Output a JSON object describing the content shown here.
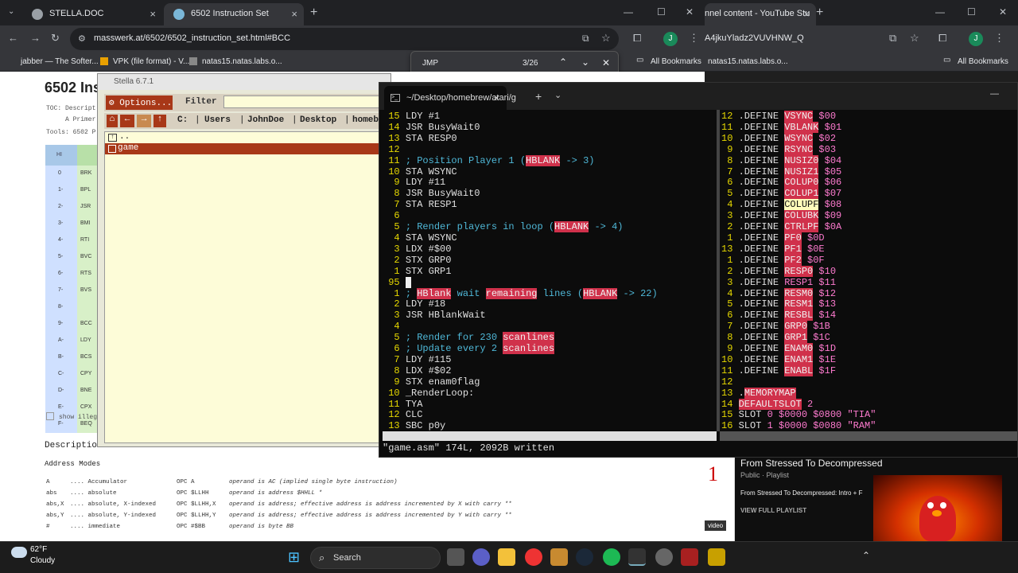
{
  "chrome_left": {
    "tabs": [
      {
        "label": "STELLA.DOC",
        "close": "×"
      },
      {
        "label": "6502 Instruction Set",
        "close": "×"
      }
    ],
    "new_tab": "+",
    "url": "masswerk.at/6502/6502_instruction_set.html#BCC",
    "bookmarks": [
      "jabber — The Softer...",
      "VPK (file format) - V...",
      "natas15.natas.labs.o..."
    ],
    "find": {
      "query": "JMP",
      "count": "3/26"
    },
    "all_bookmarks": "All Bookmarks",
    "profile": "J"
  },
  "chrome_right": {
    "tab_label": "nnel content - YouTube Stu",
    "url": "A4jkuYladz2VUVHNW_Q",
    "bookmarks": [
      "natas15.natas.labs.o..."
    ],
    "all_bookmarks": "All Bookmarks",
    "profile": "J"
  },
  "page": {
    "title": "6502 Ins",
    "toc": "TOC: Descript",
    "toc2": "A Primer",
    "tools": "Tools: 6502 P",
    "table_header": "HI",
    "opcodes": [
      {
        "hi": "0",
        "op": "BRK"
      },
      {
        "hi": "1-",
        "op": "BPL"
      },
      {
        "hi": "2-",
        "op": "JSR"
      },
      {
        "hi": "3-",
        "op": "BMI"
      },
      {
        "hi": "4-",
        "op": "RTI"
      },
      {
        "hi": "5-",
        "op": "BVC"
      },
      {
        "hi": "6-",
        "op": "RTS"
      },
      {
        "hi": "7-",
        "op": "BVS"
      },
      {
        "hi": "8-",
        "op": ""
      },
      {
        "hi": "9-",
        "op": "BCC"
      },
      {
        "hi": "A-",
        "op": "LDY"
      },
      {
        "hi": "B-",
        "op": "BCS"
      },
      {
        "hi": "C-",
        "op": "CPY"
      },
      {
        "hi": "D-",
        "op": "BNE"
      },
      {
        "hi": "E-",
        "op": "CPX"
      },
      {
        "hi": "F-",
        "op": "BEQ"
      }
    ],
    "show_illegal": "show illeg",
    "description": "Description",
    "address_modes": "Address Modes",
    "modes": [
      {
        "m": "A",
        "d": ".... Accumulator",
        "o": "OPC A",
        "e": "operand is AC (implied single byte instruction)"
      },
      {
        "m": "abs",
        "d": ".... absolute",
        "o": "OPC $LLHH",
        "e": "operand is address $HHLL *"
      },
      {
        "m": "abs,X",
        "d": ".... absolute, X-indexed",
        "o": "OPC $LLHH,X",
        "e": "operand is address; effective address is address incremented by X with carry **"
      },
      {
        "m": "abs,Y",
        "d": ".... absolute, Y-indexed",
        "o": "OPC $LLHH,Y",
        "e": "operand is address; effective address is address incremented by Y with carry **"
      },
      {
        "m": "#",
        "d": ".... immediate",
        "o": "OPC #$BB",
        "e": "operand is byte BB"
      }
    ]
  },
  "stella": {
    "title": "Stella 6.7.1",
    "options": "Options...",
    "filter": "Filter",
    "path": [
      "C:",
      "Users",
      "JohnDoe",
      "Desktop",
      "homeb"
    ],
    "items": [
      "..",
      "game"
    ]
  },
  "terminal": {
    "tab": "~/Desktop/homebrew/atari/g",
    "status": "\"game.asm\" 174L, 2092B written",
    "left_lines": [
      {
        "n": "15",
        "t": "LDY #1"
      },
      {
        "n": "14",
        "t": "JSR BusyWait0"
      },
      {
        "n": "13",
        "t": "STA RESP0"
      },
      {
        "n": "12",
        "t": ""
      },
      {
        "n": "11",
        "c": "; Position Player 1 (",
        "h": "HBLANK",
        "r": " -> 3)"
      },
      {
        "n": "10",
        "t": "STA WSYNC"
      },
      {
        "n": "9",
        "t": "LDY #11"
      },
      {
        "n": "8",
        "t": "JSR BusyWait0"
      },
      {
        "n": "7",
        "t": "STA RESP1"
      },
      {
        "n": "6",
        "t": ""
      },
      {
        "n": "5",
        "c": "; Render players in loop (",
        "h": "HBLANK",
        "r": " -> 4)"
      },
      {
        "n": "4",
        "t": "STA WSYNC"
      },
      {
        "n": "3",
        "t": "LDX #$00"
      },
      {
        "n": "2",
        "t": "STX GRP0"
      },
      {
        "n": "1",
        "t": "STX GRP1"
      },
      {
        "n": "95",
        "t": ""
      },
      {
        "n": "1",
        "special": "hblank"
      },
      {
        "n": "2",
        "t": "LDY #18"
      },
      {
        "n": "3",
        "t": "JSR HBlankWait"
      },
      {
        "n": "4",
        "t": ""
      },
      {
        "n": "5",
        "c": "; Render for 230 ",
        "h": "scanlines",
        "r": ""
      },
      {
        "n": "6",
        "c": "; Update every 2 ",
        "h": "scanlines",
        "r": ""
      },
      {
        "n": "7",
        "t": "LDY #115"
      },
      {
        "n": "8",
        "t": "LDX #$02"
      },
      {
        "n": "9",
        "t": "STX enam0flag"
      },
      {
        "n": "10",
        "t": "_RenderLoop:"
      },
      {
        "n": "11",
        "t": "TYA"
      },
      {
        "n": "12",
        "t": "CLC"
      },
      {
        "n": "13",
        "t": "SBC p0y"
      }
    ],
    "hblank_line": {
      "a": "; ",
      "b": "HBlank",
      "c": " wait ",
      "d": "remaining",
      "e": " lines (",
      "f": "HBLANK",
      "g": " -> 22)"
    },
    "right_lines": [
      {
        "n": "12",
        "k": ".DEFINE ",
        "v": "VSYNC",
        "d": " $00"
      },
      {
        "n": "11",
        "k": ".DEFINE ",
        "v": "VBLANK",
        "d": " $01"
      },
      {
        "n": "10",
        "k": ".DEFINE ",
        "v": "WSYNC",
        "d": " $02"
      },
      {
        "n": "9",
        "k": ".DEFINE ",
        "v": "RSYNC",
        "d": " $03"
      },
      {
        "n": "8",
        "k": ".DEFINE ",
        "v": "NUSIZ0",
        "d": " $04"
      },
      {
        "n": "7",
        "k": ".DEFINE ",
        "v": "NUSIZ1",
        "d": " $05"
      },
      {
        "n": "6",
        "k": ".DEFINE ",
        "v": "COLUP0",
        "d": " $06"
      },
      {
        "n": "5",
        "k": ".DEFINE ",
        "v": "COLUP1",
        "d": " $07"
      },
      {
        "n": "4",
        "k": ".DEFINE ",
        "v": "COLUPF",
        "d": " $08",
        "y": true
      },
      {
        "n": "3",
        "k": ".DEFINE ",
        "v": "COLUBK",
        "d": " $09"
      },
      {
        "n": "2",
        "k": ".DEFINE ",
        "v": "CTRLPF",
        "d": " $0A"
      },
      {
        "n": "1",
        "k": ".DEFINE ",
        "v": "PF0",
        "d": " $0D"
      },
      {
        "n": "13",
        "k": ".DEFINE ",
        "v": "PF1",
        "d": " $0E"
      },
      {
        "n": "1",
        "k": ".DEFINE ",
        "v": "PF2",
        "d": " $0F"
      },
      {
        "n": "2",
        "k": ".DEFINE ",
        "v": "RESP0",
        "d": " $10"
      },
      {
        "n": "3",
        "k": ".DEFINE ",
        "v": "",
        "d": "RESP1 $11"
      },
      {
        "n": "4",
        "k": ".DEFINE ",
        "v": "RESM0",
        "d": " $12"
      },
      {
        "n": "5",
        "k": ".DEFINE ",
        "v": "RESM1",
        "d": " $13"
      },
      {
        "n": "6",
        "k": ".DEFINE ",
        "v": "RESBL",
        "d": " $14"
      },
      {
        "n": "7",
        "k": ".DEFINE ",
        "v": "GRP0",
        "d": " $1B"
      },
      {
        "n": "8",
        "k": ".DEFINE ",
        "v": "GRP1",
        "d": " $1C"
      },
      {
        "n": "9",
        "k": ".DEFINE ",
        "v": "ENAM0",
        "d": " $1D"
      },
      {
        "n": "10",
        "k": ".DEFINE ",
        "v": "ENAM1",
        "d": " $1E"
      },
      {
        "n": "11",
        "k": ".DEFINE ",
        "v": "ENABL",
        "d": " $1F"
      },
      {
        "n": "12",
        "k": "",
        "v": "",
        "d": ""
      },
      {
        "n": "13",
        "k": ".",
        "v": "MEMORYMAP",
        "d": ""
      },
      {
        "n": "14",
        "k": "",
        "v": "DEFAULTSLOT",
        "d": " 2"
      },
      {
        "n": "15",
        "k": "SLOT ",
        "v": "",
        "d": "0 $0000 $0800 \"TIA\""
      },
      {
        "n": "16",
        "k": "SLOT ",
        "v": "",
        "d": "1 $0000 $0080 \"RAM\""
      }
    ]
  },
  "youtube": {
    "playlist_title": "From Stressed To Decompressed",
    "playlist_meta": "Public · Playlist",
    "item": "From Stressed To Decompressed: Intro + F",
    "view_full": "VIEW FULL PLAYLIST",
    "badge": "1",
    "video_tag": "video"
  },
  "taskbar": {
    "weather_temp": "62°F",
    "weather_desc": "Cloudy",
    "search": "Search"
  }
}
